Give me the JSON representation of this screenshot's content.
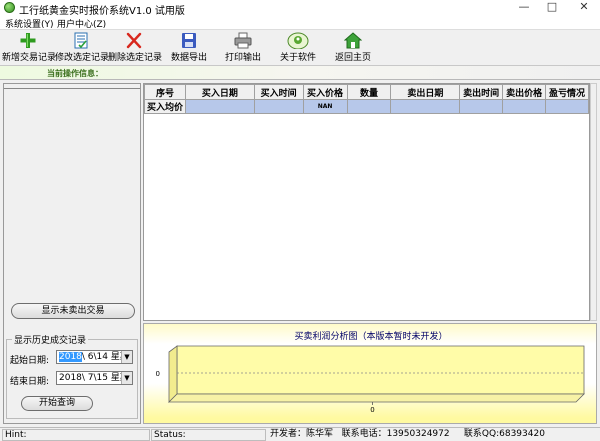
{
  "window": {
    "title": "工行纸黄金实时报价系统V1.0 试用版",
    "min": "—",
    "max": "□",
    "close": "✕"
  },
  "menu": {
    "items": [
      "系统设置(Y)",
      "用户中心(Z)"
    ]
  },
  "toolbar": {
    "items": [
      {
        "label": "新增交易记录",
        "icon": "plus-icon"
      },
      {
        "label": "修改选定记录",
        "icon": "edit-icon"
      },
      {
        "label": "删除选定记录",
        "icon": "delete-icon"
      },
      {
        "label": "数据导出",
        "icon": "save-icon"
      },
      {
        "label": "打印输出",
        "icon": "printer-icon"
      },
      {
        "label": "关于软件",
        "icon": "about-icon"
      },
      {
        "label": "返回主页",
        "icon": "home-icon"
      }
    ]
  },
  "status_info": {
    "label": "当前操作信息："
  },
  "left": {
    "show_unsold_button": "显示未卖出交易",
    "history_group": "显示历史成交记录",
    "start_label": "起始日期:",
    "start_year": "2018",
    "start_rest": "\\ 6\\14  星期",
    "end_label": "结束日期:",
    "end_value": "2018\\ 7\\15  星期",
    "query_button": "开始查询",
    "dropdown_glyph": "▼"
  },
  "grid": {
    "columns": [
      "序号",
      "买入日期",
      "买入时间",
      "买入价格",
      "数量",
      "卖出日期",
      "卖出时间",
      "卖出价格",
      "盈亏情况"
    ],
    "avg_row_label": "买入均价",
    "avg_row_price": "NAN"
  },
  "chart_data": {
    "type": "bar",
    "title": "买卖利润分析图（本版本暂时未开发）",
    "categories": [
      "0"
    ],
    "values": [
      0
    ],
    "ylim": [
      0,
      0
    ],
    "y_tick_labels": [
      "0"
    ],
    "x_tick_labels": [
      "0"
    ],
    "grid": true
  },
  "statusbar": {
    "hint": "Hint:",
    "status": "Status:",
    "developer": "开发者：陈华军",
    "phone": "联系电话：13950324972",
    "qq": "联系QQ:68393420"
  },
  "colors": {
    "chart_fill": "#fffca8",
    "grid_selected_row": "#b7c8ea",
    "accent_green": "#3a6f1c"
  }
}
